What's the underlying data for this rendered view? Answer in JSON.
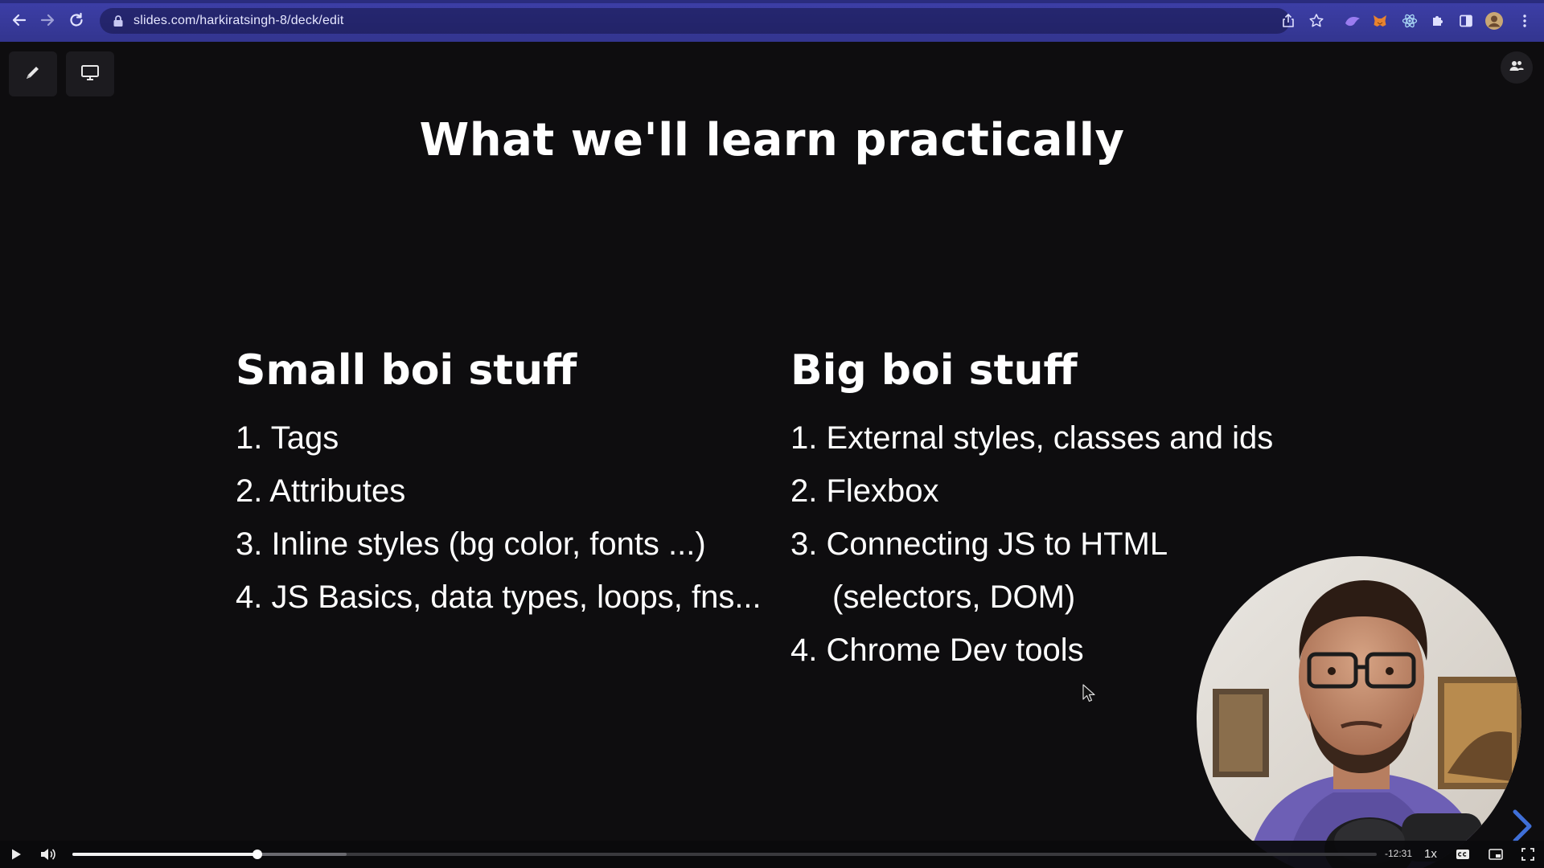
{
  "browser": {
    "url": "slides.com/harkiratsingh-8/deck/edit",
    "nav_back_icon": "arrow-left-icon",
    "nav_forward_icon": "arrow-right-icon",
    "reload_icon": "reload-icon",
    "accent_color": "#3d3fa8"
  },
  "slide": {
    "title": "What we'll learn practically",
    "left_column": {
      "heading": "Small boi stuff",
      "items": [
        "1. Tags",
        "2. Attributes",
        "3. Inline styles (bg color, fonts ...)",
        "4. JS Basics, data types, loops, fns..."
      ]
    },
    "right_column": {
      "heading": "Big boi stuff",
      "items": [
        "1. External styles, classes and ids",
        "2. Flexbox",
        "3. Connecting JS to HTML",
        "(selectors, DOM)",
        "4. Chrome Dev tools"
      ]
    },
    "background_color": "#0e0d0f",
    "text_color": "#ffffff"
  },
  "player": {
    "progress_percent": 14.2,
    "buffered_percent": 21,
    "time_remaining": "-12:31",
    "speed": "1x"
  }
}
